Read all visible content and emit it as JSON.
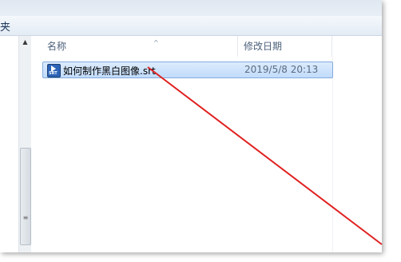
{
  "window": {
    "title_fragment": "夹"
  },
  "columns": {
    "name": "名称",
    "date": "修改日期"
  },
  "files": [
    {
      "name": "如何制作黑白图像.srt",
      "modified": "2019/5/8 20:13",
      "icon": "srt-file-icon"
    }
  ],
  "scrollbar": {
    "grip": "≡",
    "up_arrow": "▲"
  },
  "annotation": {
    "color": "#e02020",
    "shape": "arrow-line"
  }
}
